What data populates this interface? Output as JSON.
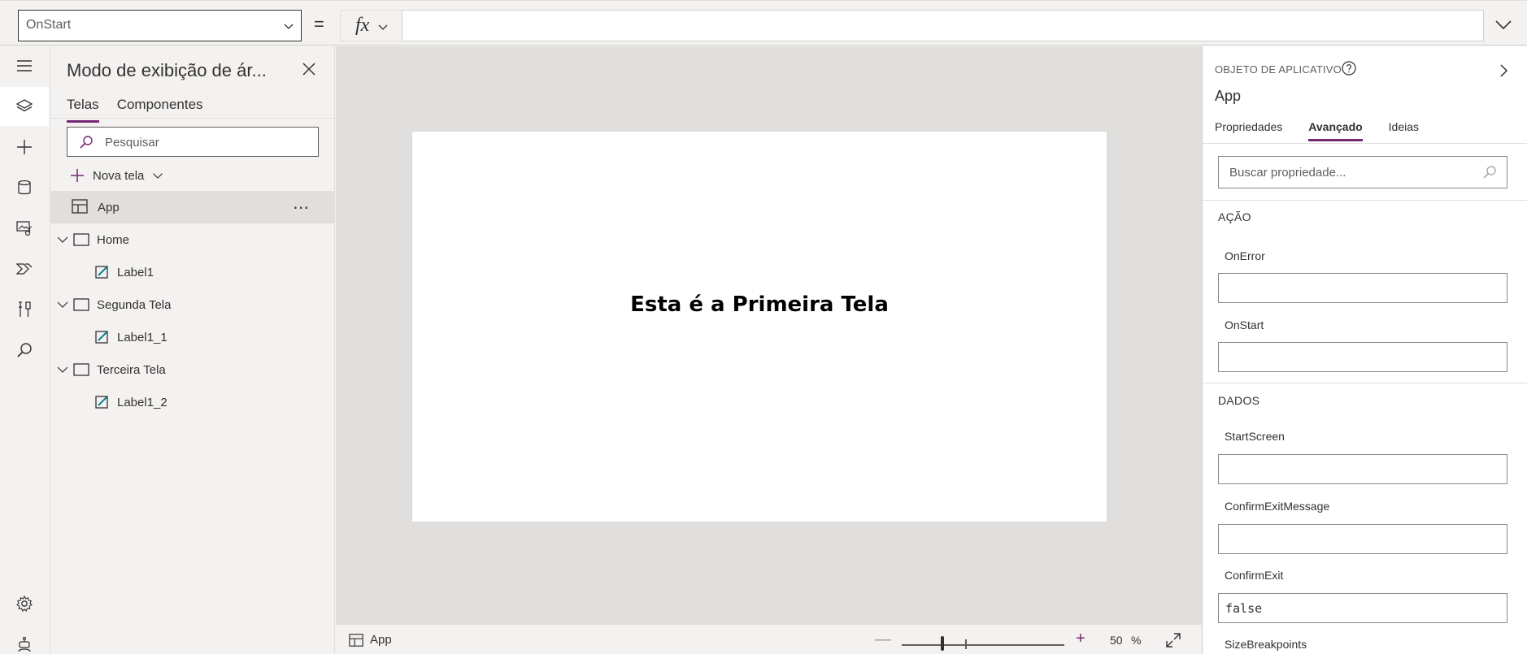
{
  "formula_bar": {
    "property": "OnStart",
    "equals": "=",
    "fx": "fx",
    "formula": ""
  },
  "rail": {
    "items": [
      "hamburger-icon",
      "tree-view-icon",
      "insert-icon",
      "data-icon",
      "media-icon",
      "power-automate-icon",
      "advanced-tools-icon",
      "search-icon",
      "settings-icon",
      "virtual-agent-icon"
    ]
  },
  "tree": {
    "title": "Modo de exibição de ár...",
    "tabs": [
      "Telas",
      "Componentes"
    ],
    "search_placeholder": "Pesquisar",
    "new_screen": "Nova tela",
    "more": "⋯",
    "items": [
      {
        "label": "App"
      },
      {
        "label": "Home"
      },
      {
        "label": "Label1"
      },
      {
        "label": "Segunda Tela"
      },
      {
        "label": "Label1_1"
      },
      {
        "label": "Terceira Tela"
      },
      {
        "label": "Label1_2"
      }
    ]
  },
  "canvas": {
    "screen_text": "Esta é a Primeira Tela"
  },
  "status": {
    "selected": "App",
    "zoom_minus": "—",
    "zoom_plus": "+",
    "zoom": "50",
    "zoom_unit": "%",
    "zoom_fraction": 0.25
  },
  "props": {
    "kind": "OBJETO DE APLICATIVO",
    "name": "App",
    "tabs": [
      "Propriedades",
      "Avançado",
      "Ideias"
    ],
    "search_placeholder": "Buscar propriedade...",
    "sections": [
      {
        "title": "AÇÃO",
        "fields": [
          {
            "label": "OnError",
            "value": ""
          },
          {
            "label": "OnStart",
            "value": ""
          }
        ]
      },
      {
        "title": "DADOS",
        "fields": [
          {
            "label": "StartScreen",
            "value": ""
          },
          {
            "label": "ConfirmExitMessage",
            "value": ""
          },
          {
            "label": "ConfirmExit",
            "value": "false"
          },
          {
            "label": "SizeBreakpoints",
            "value": ""
          }
        ]
      }
    ]
  },
  "colors": {
    "accent": "#742774",
    "chrome": "#f3f2f1",
    "canvas_bg": "#e1dfdd"
  }
}
